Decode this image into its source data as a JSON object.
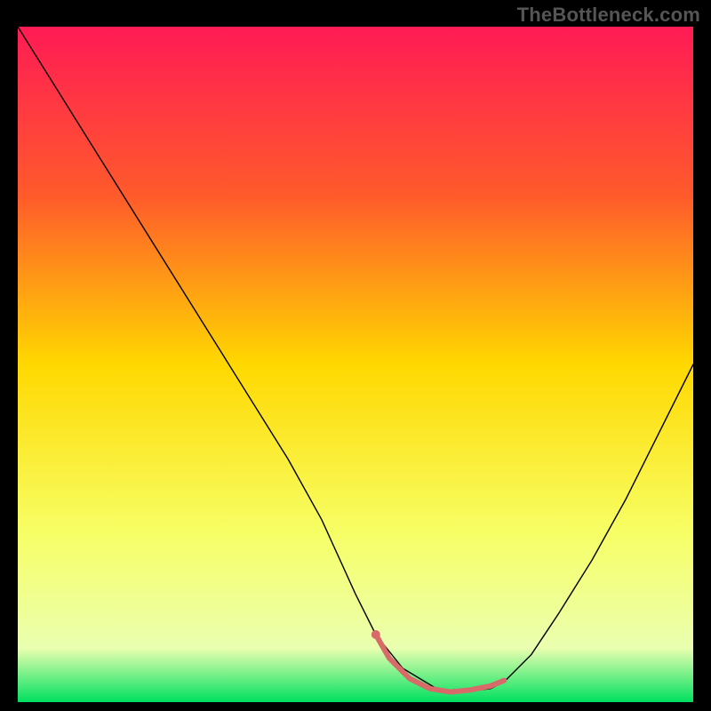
{
  "watermark": "TheBottleneck.com",
  "chart_data": {
    "type": "line",
    "title": "",
    "xlabel": "",
    "ylabel": "",
    "xlim": [
      0,
      100
    ],
    "ylim": [
      0,
      100
    ],
    "background_gradient": {
      "stops": [
        {
          "offset": 0,
          "color": "#ff1b55"
        },
        {
          "offset": 25,
          "color": "#ff5a2b"
        },
        {
          "offset": 50,
          "color": "#ffd800"
        },
        {
          "offset": 75,
          "color": "#f7ff66"
        },
        {
          "offset": 92,
          "color": "#eaffb0"
        },
        {
          "offset": 100,
          "color": "#00e060"
        }
      ]
    },
    "series": [
      {
        "name": "bottleneck-curve",
        "color": "#000000",
        "width": 1.4,
        "x": [
          0,
          5,
          10,
          15,
          20,
          25,
          30,
          35,
          40,
          45,
          50,
          53,
          57,
          62,
          66,
          70,
          72,
          76,
          80,
          85,
          90,
          95,
          100
        ],
        "y": [
          100,
          92,
          84,
          76,
          68,
          60,
          52,
          44,
          36,
          27,
          16,
          10,
          5,
          2,
          1.5,
          2,
          3,
          7,
          13,
          21,
          30,
          40,
          50
        ]
      },
      {
        "name": "optimal-band",
        "color": "#d86a6a",
        "width": 6,
        "x": [
          53,
          55,
          58,
          61,
          64,
          67,
          70,
          72
        ],
        "y": [
          10,
          6.5,
          3.5,
          2.0,
          1.5,
          1.8,
          2.4,
          3.2
        ]
      },
      {
        "name": "optimal-start-dot",
        "type": "scatter",
        "color": "#d86a6a",
        "radius": 5,
        "x": [
          53
        ],
        "y": [
          10
        ]
      }
    ]
  }
}
